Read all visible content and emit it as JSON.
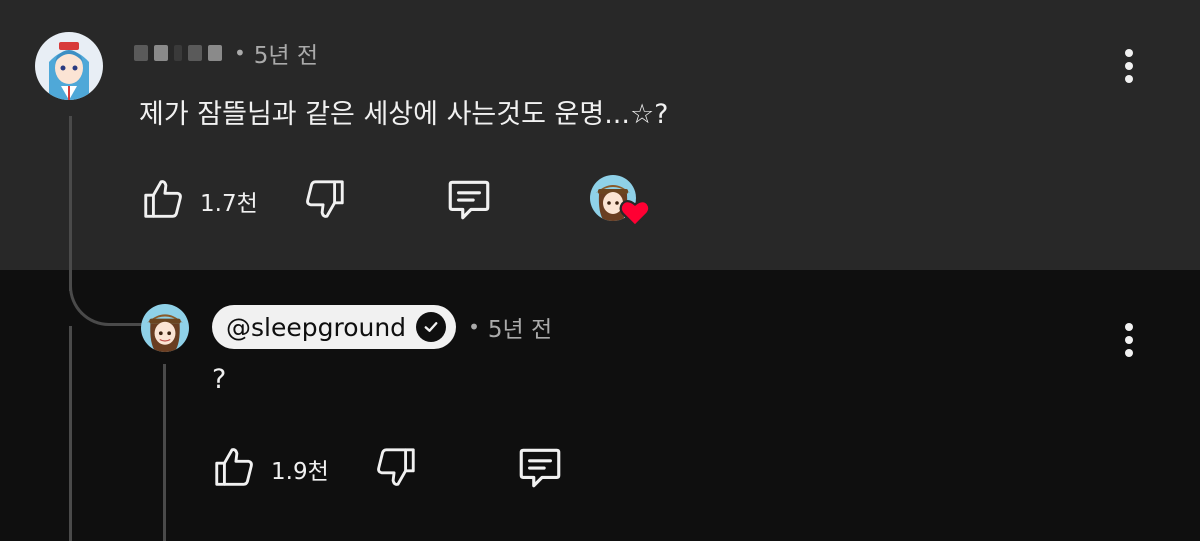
{
  "parent_comment": {
    "time_ago": "5년 전",
    "text": "제가 잠뜰님과 같은 세상에 사는것도 운명...☆?",
    "like_count": "1.7천",
    "icons": {
      "like": "thumbs-up-icon",
      "dislike": "thumbs-down-icon",
      "reply": "reply-icon",
      "creator_heart": "creator-heart-icon",
      "more": "more-vert-icon"
    }
  },
  "reply_comment": {
    "handle": "@sleepground",
    "time_ago": "5년 전",
    "text": "?",
    "like_count": "1.9천",
    "icons": {
      "verified": "verified-check-icon",
      "like": "thumbs-up-icon",
      "dislike": "thumbs-down-icon",
      "reply": "reply-icon",
      "more": "more-vert-icon"
    }
  },
  "colors": {
    "top_background": "#282828",
    "bottom_background": "#0f0f0f",
    "text_primary": "#f1f1f1",
    "text_secondary": "#aaaaaa",
    "heart": "#ff0033"
  }
}
